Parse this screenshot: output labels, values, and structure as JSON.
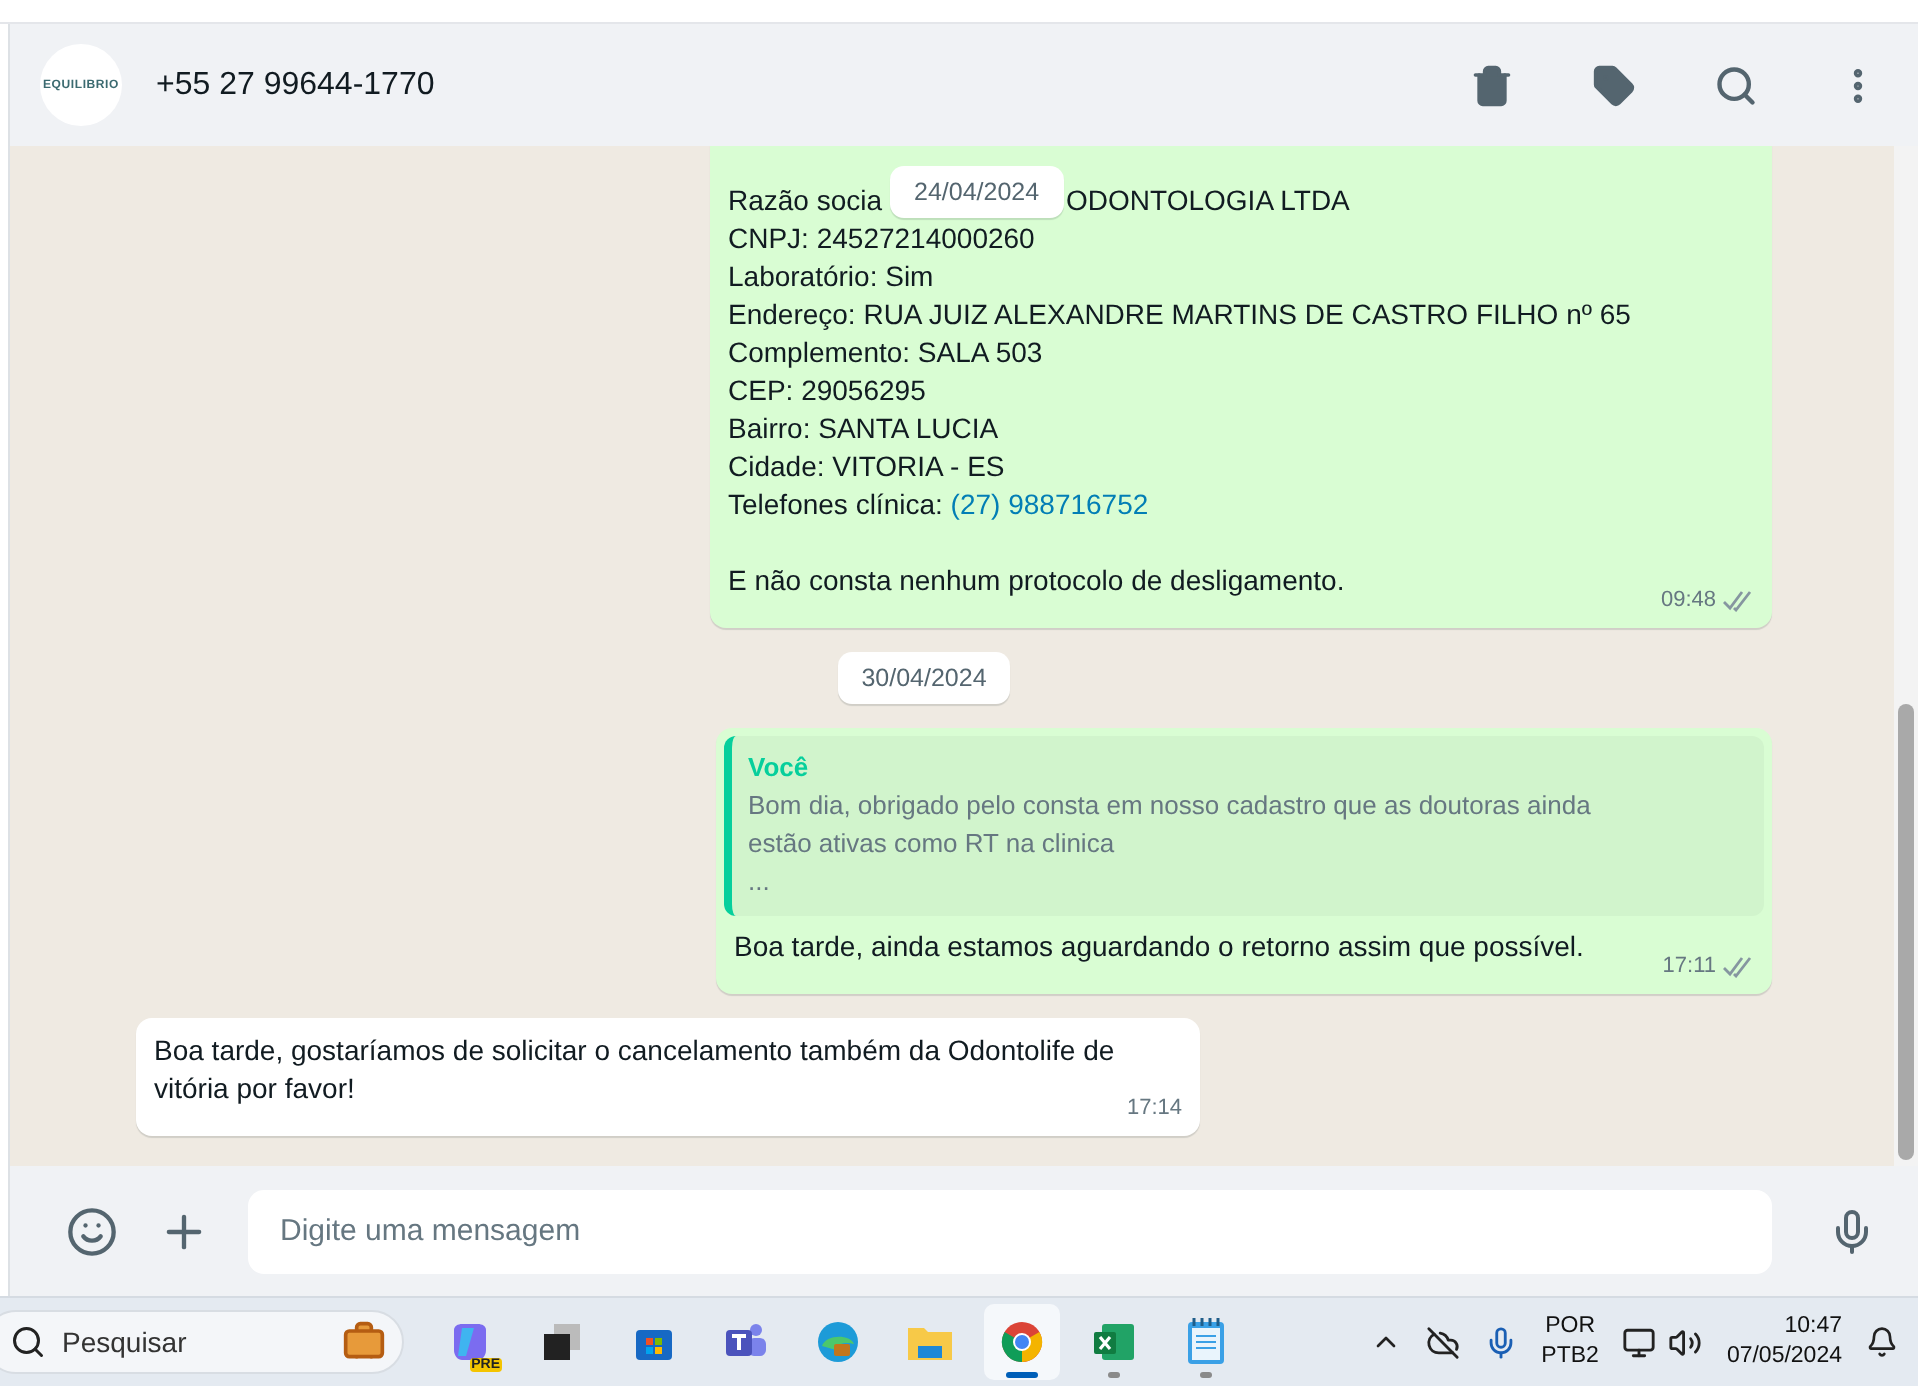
{
  "header": {
    "logo_text": "EQUILIBRIO",
    "contact": "+55 27 99644-1770"
  },
  "sticky_date": "24/04/2024",
  "messages": [
    {
      "kind": "outgoing",
      "read": false,
      "time": "09:48",
      "paragraphs": [
        [
          {
            "text": "Razão socia",
            "after": "ODONTOLOGIA LTDA"
          },
          {
            "text": "CNPJ: 24527214000260"
          },
          {
            "text": "Laboratório: Sim"
          },
          {
            "text": "Endereço: RUA JUIZ ALEXANDRE MARTINS DE CASTRO FILHO nº 65"
          },
          {
            "text": "Complemento: SALA 503"
          },
          {
            "text": "CEP: 29056295"
          },
          {
            "text": "Bairro: SANTA LUCIA"
          },
          {
            "text": "Cidade: VITORIA - ES"
          },
          {
            "text": "Telefones clínica: ",
            "link": "(27) 988716752"
          }
        ],
        [
          {
            "text": "E não consta nenhum protocolo de desligamento."
          }
        ]
      ]
    },
    {
      "kind": "date",
      "text": "30/04/2024"
    },
    {
      "kind": "outgoing",
      "read": false,
      "time": "17:11",
      "quote": {
        "author": "Você",
        "lines": [
          "Bom dia, obrigado pelo consta em nosso cadastro que as doutoras ainda",
          "estão ativas como RT na clinica",
          "..."
        ]
      },
      "paragraphs": [
        [
          {
            "text": "Boa tarde, ainda estamos aguardando o retorno assim que possível."
          }
        ]
      ]
    },
    {
      "kind": "incoming",
      "time": "17:14",
      "paragraphs": [
        [
          {
            "text": "Boa tarde, gostaríamos de solicitar o cancelamento também da Odontolife de vitória por favor!"
          }
        ]
      ]
    }
  ],
  "composer": {
    "placeholder": "Digite uma mensagem"
  },
  "taskbar": {
    "search_placeholder": "Pesquisar",
    "apps": [
      {
        "kind": "copilot",
        "badge": "PRE",
        "running": false,
        "selected": false
      },
      {
        "kind": "taskview",
        "running": false,
        "selected": false
      },
      {
        "kind": "store",
        "running": false,
        "selected": false
      },
      {
        "kind": "teams",
        "running": false,
        "selected": false
      },
      {
        "kind": "edge",
        "running": false,
        "selected": false
      },
      {
        "kind": "explorer",
        "running": false,
        "selected": false
      },
      {
        "kind": "chrome",
        "running": true,
        "selected": true
      },
      {
        "kind": "excel",
        "running": true,
        "selected": false
      },
      {
        "kind": "notepad",
        "running": true,
        "selected": false
      }
    ],
    "language": [
      "POR",
      "PTB2"
    ],
    "time": "10:47",
    "date": "07/05/2024"
  }
}
